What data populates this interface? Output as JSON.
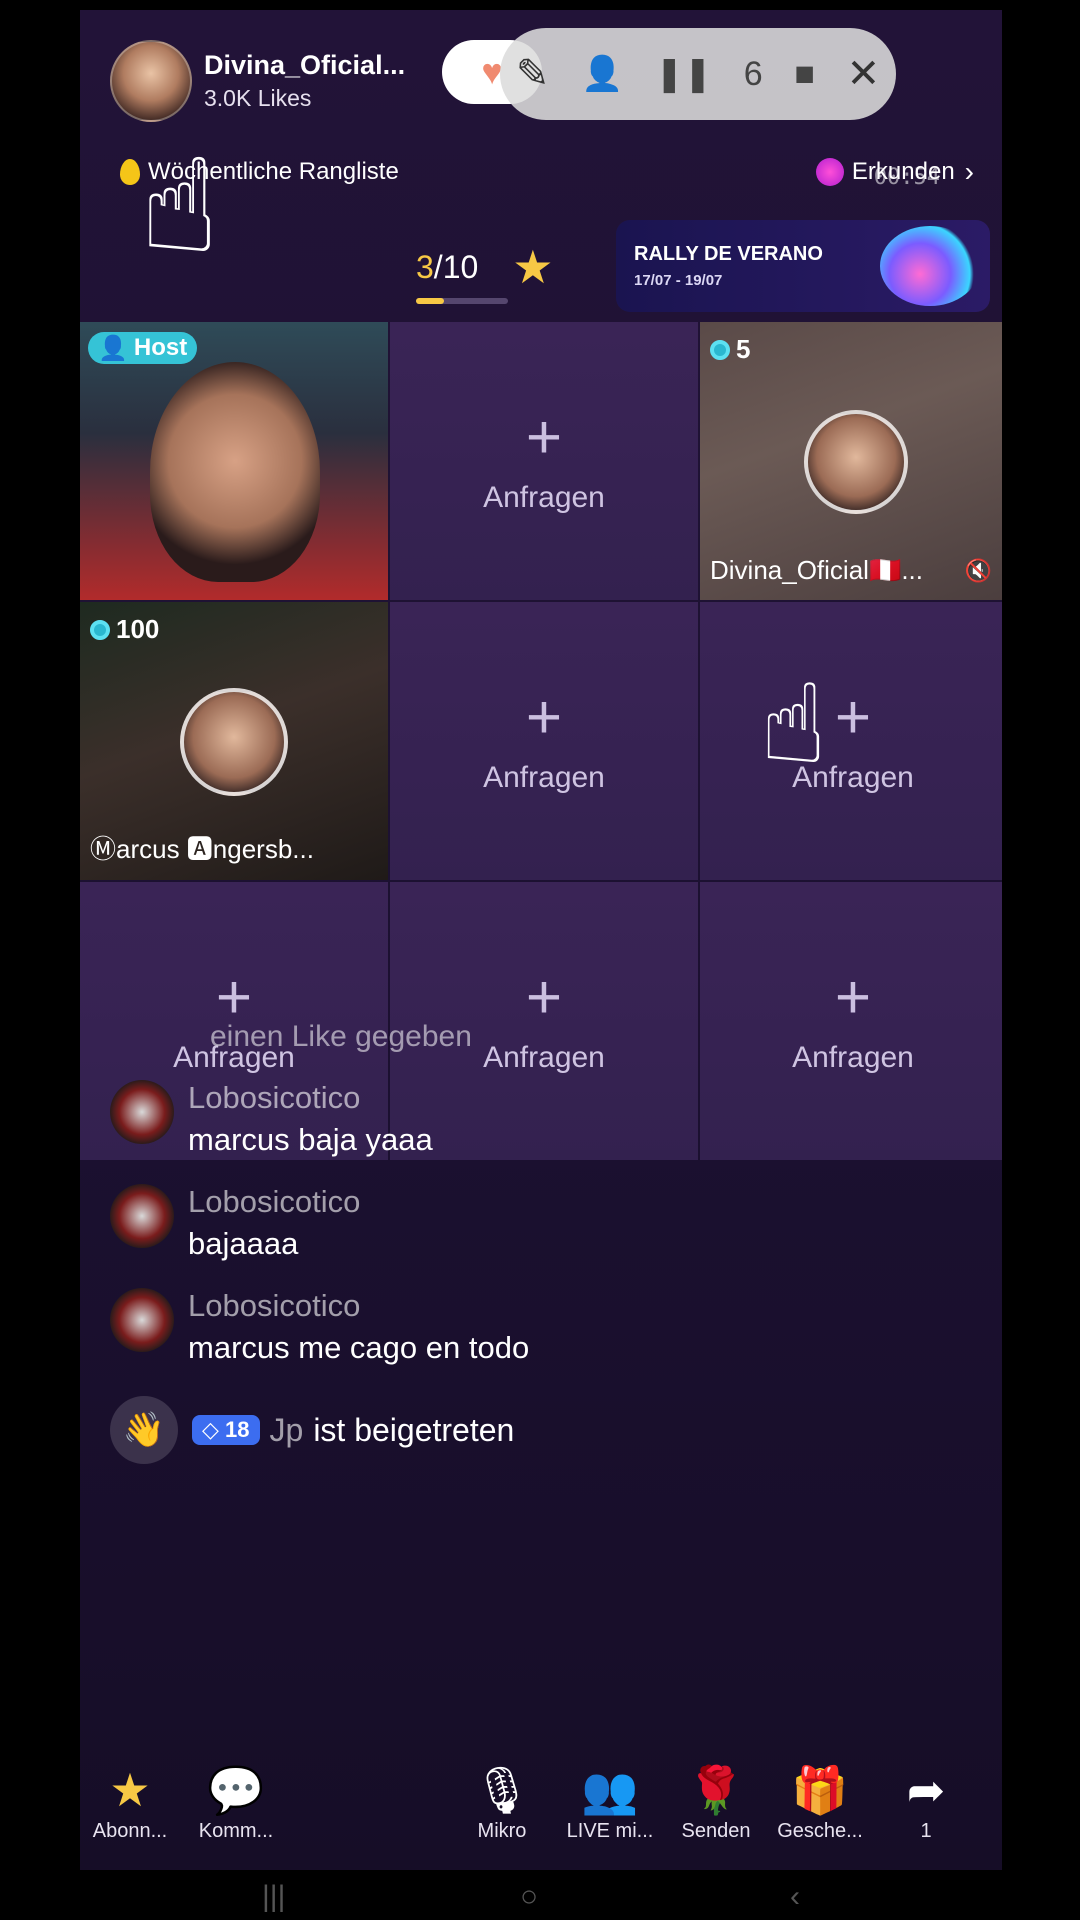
{
  "header": {
    "host_name": "Divina_Oficial...",
    "likes": "3.0K Likes",
    "rank_label": "Wöchentliche Rangliste",
    "explore_label": "Erkunden",
    "timer": "00:54"
  },
  "recorder": {
    "count": "6"
  },
  "progress": {
    "current": "3",
    "total": "/10",
    "fraction": 0.3
  },
  "banner": {
    "title": "RALLY DE VERANO",
    "dates": "17/07 - 19/07"
  },
  "grid": {
    "host_badge": "Host",
    "request_label": "Anfragen",
    "guest1": {
      "count": "5",
      "name": "Divina_Oficial🇵🇪..."
    },
    "guest2": {
      "count": "100",
      "name": "Ⓜarcus 🅰ngersb..."
    }
  },
  "chat": {
    "faded": "einen Like gegeben",
    "messages": [
      {
        "user": "Lobosicotico",
        "text": "marcus baja yaaa"
      },
      {
        "user": "Lobosicotico",
        "text": "bajaaaa"
      },
      {
        "user": "Lobosicotico",
        "text": "marcus me cago en todo"
      }
    ],
    "join": {
      "level": "18",
      "name": "Jp",
      "text": "ist beigetreten"
    }
  },
  "bottom": {
    "subscribe": "Abonn...",
    "comment": "Komm...",
    "mic": "Mikro",
    "live": "LIVE mi...",
    "send": "Senden",
    "gift": "Gesche...",
    "share_count": "1"
  },
  "icons": {
    "heart": "heart-icon",
    "pencil": "pencil-icon",
    "pause": "pause-icon",
    "stop": "stop-icon",
    "close": "close-icon",
    "star": "star-icon",
    "mic": "mic-icon",
    "gift": "gift-icon",
    "share": "share-icon",
    "rose": "rose-icon",
    "wave": "wave-icon"
  },
  "colors": {
    "accent_yellow": "#f7c845",
    "host_badge": "#35c3d6",
    "level_badge": "#3c6df0"
  }
}
